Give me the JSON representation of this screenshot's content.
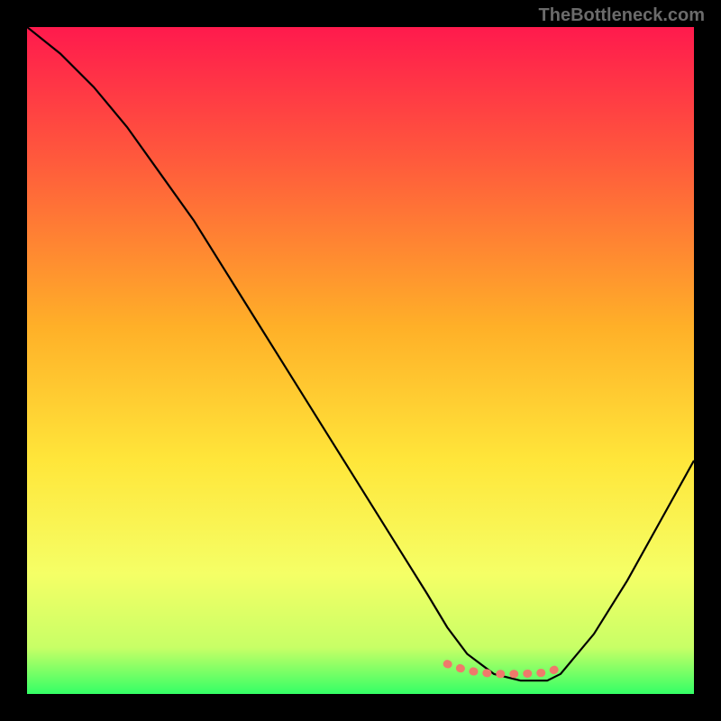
{
  "watermark": "TheBottleneck.com",
  "chart_data": {
    "type": "line",
    "title": "",
    "xlabel": "",
    "ylabel": "",
    "xlim": [
      0,
      100
    ],
    "ylim": [
      0,
      100
    ],
    "grid": false,
    "background": "red-yellow-green-vertical-gradient",
    "series": [
      {
        "name": "curve",
        "color": "#000000",
        "x": [
          0,
          5,
          10,
          15,
          20,
          25,
          30,
          35,
          40,
          45,
          50,
          55,
          60,
          63,
          66,
          70,
          74,
          78,
          80,
          85,
          90,
          95,
          100
        ],
        "y": [
          100,
          96,
          91,
          85,
          78,
          71,
          63,
          55,
          47,
          39,
          31,
          23,
          15,
          10,
          6,
          3,
          2,
          2,
          3,
          9,
          17,
          26,
          35
        ]
      }
    ],
    "highlight_segment": {
      "color": "#ef7a6b",
      "x": [
        63,
        66,
        70,
        74,
        78,
        80
      ],
      "y": [
        4.5,
        3.5,
        3,
        3,
        3.2,
        4
      ]
    },
    "gradient_stops": [
      {
        "offset": 0.0,
        "color": "#ff1a4d"
      },
      {
        "offset": 0.2,
        "color": "#ff5a3c"
      },
      {
        "offset": 0.45,
        "color": "#ffb028"
      },
      {
        "offset": 0.65,
        "color": "#ffe63a"
      },
      {
        "offset": 0.82,
        "color": "#f5ff66"
      },
      {
        "offset": 0.93,
        "color": "#c8ff66"
      },
      {
        "offset": 1.0,
        "color": "#34ff66"
      }
    ]
  }
}
